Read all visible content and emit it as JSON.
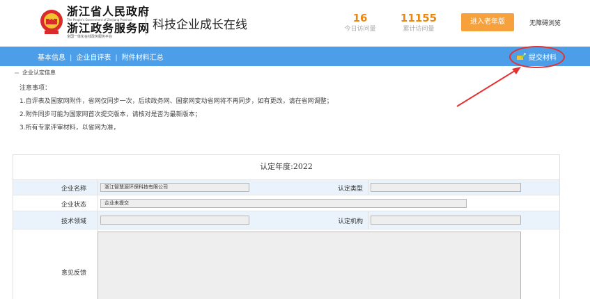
{
  "header": {
    "logo_line1": "浙江省人民政府",
    "logo_sub1": "The People's Government of Zhejiang Province",
    "logo_line2": "浙江政务服务网",
    "logo_sub2": "全国一体化在线政务服务平台",
    "site_title": "科技企业成长在线",
    "stats": [
      {
        "value": "16",
        "label": "今日访问量"
      },
      {
        "value": "11155",
        "label": "累计访问量"
      }
    ],
    "elder_button": "进入老年版",
    "accessibility_link": "无障碍浏览"
  },
  "nav": {
    "items": [
      "基本信息",
      "企业自评表",
      "附件材料汇总"
    ],
    "separator": "|",
    "submit_label": "提交材料"
  },
  "section": {
    "title": "企业认定信息",
    "notes": [
      "注意事项：",
      "1.自评表及国家网附件，省网仅同步一次，后续政务网、国家网变动省网将不再同步，如有更改，请在省网调整；",
      "2.附件同步可能为国家网首次提交版本，请核对是否为最新版本；",
      "3.所有专家评审材料，以省网为准，"
    ]
  },
  "form": {
    "year_title": "认定年度:2022",
    "company_name_label": "企业名称",
    "company_name_value": "浙江智慧源环保科技有限公司",
    "cert_type_label": "认定类型",
    "cert_type_value": "",
    "company_status_label": "企业状态",
    "company_status_value": "企业未提交",
    "tech_field_label": "技术领域",
    "tech_field_value": "",
    "cert_agency_label": "认定机构",
    "cert_agency_value": "",
    "feedback_label": "意见反馈"
  },
  "colors": {
    "nav_blue": "#4c9ee8",
    "stat_orange": "#e9870f",
    "elder_button_orange": "#f6a13c",
    "annotation_red": "#e23232"
  }
}
